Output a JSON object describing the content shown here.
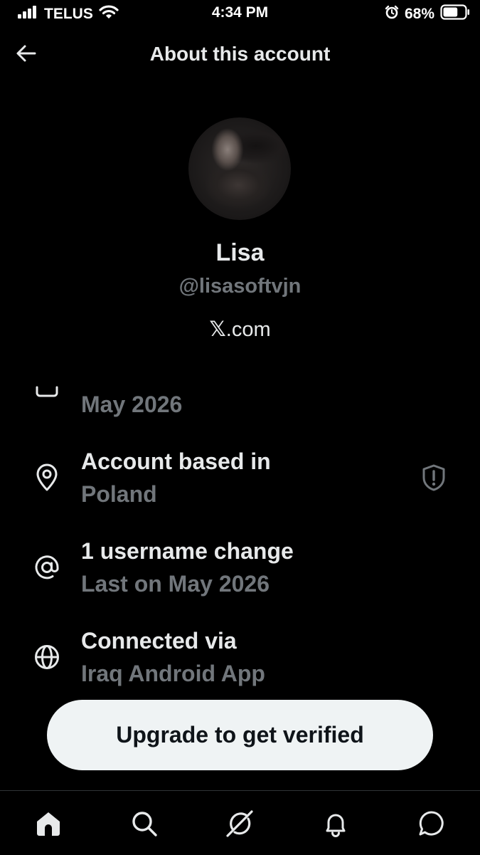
{
  "status_bar": {
    "carrier": "TELUS",
    "time": "4:34 PM",
    "battery_percent": "68%",
    "battery_level": 0.68,
    "icons": [
      "signal-icon",
      "wifi-icon",
      "alarm-icon",
      "battery-icon"
    ]
  },
  "header": {
    "title": "About this account",
    "back_icon": "back-arrow-icon"
  },
  "profile": {
    "name": "Lisa",
    "handle": "@lisasoftvjn",
    "site_mark": "𝕏",
    "site_suffix": ".com"
  },
  "details": {
    "joined": {
      "icon": "calendar-icon",
      "value": "May 2026"
    },
    "location": {
      "icon": "location-pin-icon",
      "title": "Account based in",
      "value": "Poland",
      "badge_icon": "shield-alert-icon"
    },
    "username": {
      "icon": "at-sign-icon",
      "title": "1 username change",
      "value": "Last on May 2026"
    },
    "connection": {
      "icon": "globe-icon",
      "title": "Connected via",
      "value": "Iraq Android App"
    }
  },
  "cta": {
    "label": "Upgrade to get verified"
  },
  "tab_bar": {
    "items": [
      "home-icon",
      "search-icon",
      "grok-icon",
      "notifications-icon",
      "messages-icon"
    ],
    "active": "home-icon"
  },
  "colors": {
    "background": "#000000",
    "primary_text": "#e7e9ea",
    "secondary_text": "#71767b",
    "button_bg": "#eff3f4",
    "button_text": "#0f1419",
    "divider": "#2f3336"
  }
}
